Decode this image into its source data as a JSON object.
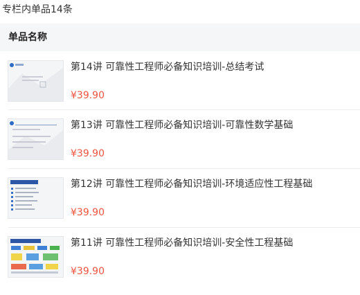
{
  "summary": "专栏内单品14条",
  "header": {
    "label": "单品名称"
  },
  "items": [
    {
      "title": "第14讲 可靠性工程师必备知识培训-总结考试",
      "price": "¥39.90",
      "thumb_icon": "slide-thumbnail-icon"
    },
    {
      "title": "第13讲 可靠性工程师必备知识培训-可靠性数学基础",
      "price": "¥39.90",
      "thumb_icon": "slide-thumbnail-icon"
    },
    {
      "title": "第12讲 可靠性工程师必备知识培训-环境适应性工程基础",
      "price": "¥39.90",
      "thumb_icon": "slide-thumbnail-icon"
    },
    {
      "title": "第11讲 可靠性工程师必备知识培训-安全性工程基础",
      "price": "¥39.90",
      "thumb_icon": "slide-thumbnail-icon"
    }
  ],
  "colors": {
    "price": "#f0533f",
    "header_bg": "#f5f6f8",
    "divider": "#ececec"
  }
}
